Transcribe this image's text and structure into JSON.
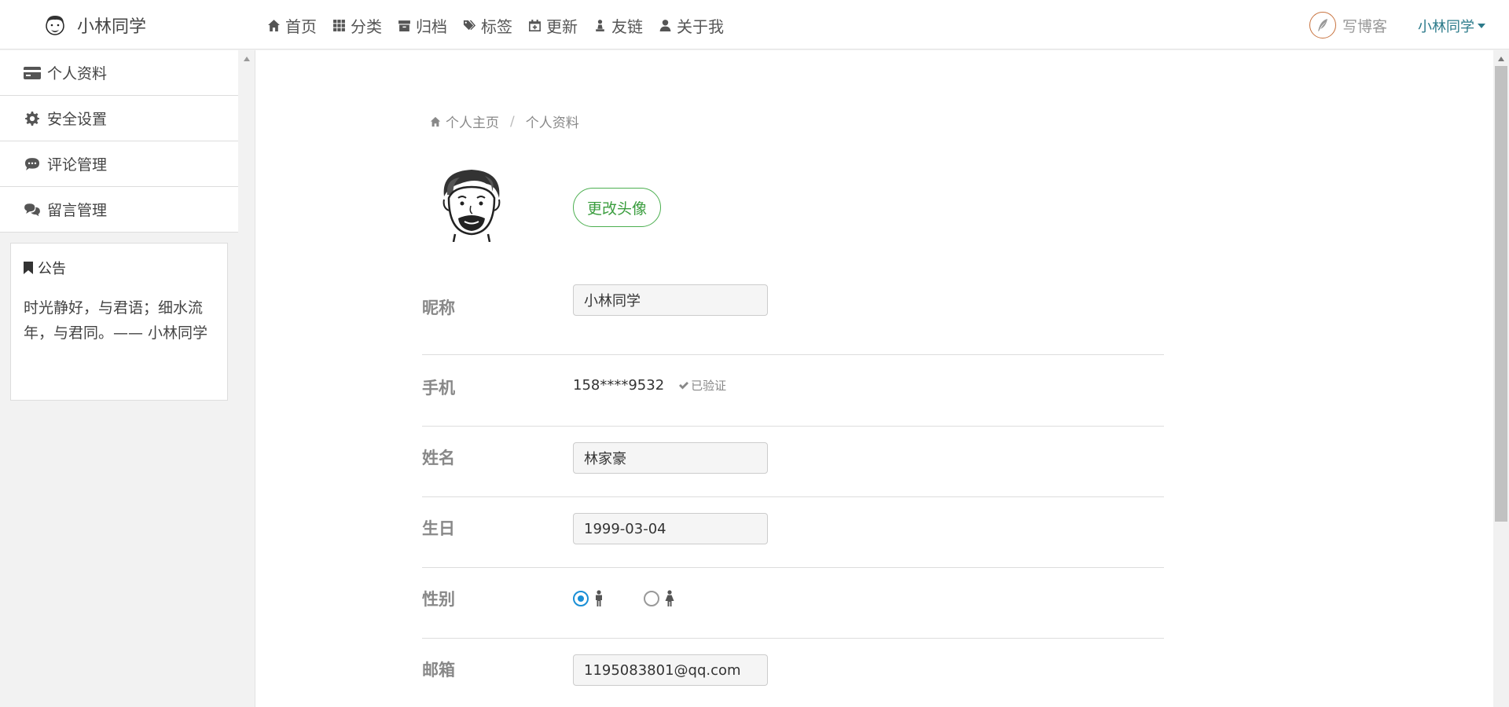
{
  "header": {
    "brand": "小林同学",
    "nav": [
      {
        "label": "首页",
        "icon": "home-icon"
      },
      {
        "label": "分类",
        "icon": "grid-icon"
      },
      {
        "label": "归档",
        "icon": "archive-icon"
      },
      {
        "label": "标签",
        "icon": "tags-icon"
      },
      {
        "label": "更新",
        "icon": "calendar-plus-icon"
      },
      {
        "label": "友链",
        "icon": "chess-pawn-icon"
      },
      {
        "label": "关于我",
        "icon": "user-icon"
      }
    ],
    "write_blog": "写博客",
    "user": "小林同学"
  },
  "sidebar": {
    "items": [
      {
        "label": "个人资料",
        "icon": "credit-card-icon"
      },
      {
        "label": "安全设置",
        "icon": "gear-icon"
      },
      {
        "label": "评论管理",
        "icon": "comment-icon"
      },
      {
        "label": "留言管理",
        "icon": "comments-icon"
      }
    ],
    "notice": {
      "title": "公告",
      "body": "时光静好，与君语；细水流年，与君同。—— 小林同学"
    }
  },
  "main": {
    "breadcrumb": {
      "home": "个人主页",
      "current": "个人资料"
    },
    "change_avatar": "更改头像",
    "form": {
      "nickname": {
        "label": "昵称",
        "value": "小林同学"
      },
      "phone": {
        "label": "手机",
        "value": "158****9532",
        "verified": "已验证"
      },
      "name": {
        "label": "姓名",
        "value": "林家豪"
      },
      "birthday": {
        "label": "生日",
        "value": "1999-03-04"
      },
      "gender": {
        "label": "性别",
        "selected": "male"
      },
      "email": {
        "label": "邮箱",
        "value": "1195083801@qq.com"
      }
    }
  },
  "colors": {
    "accent_green": "#4caf50",
    "radio_blue": "#1a8fd6",
    "link_teal": "#2b7a8a"
  }
}
